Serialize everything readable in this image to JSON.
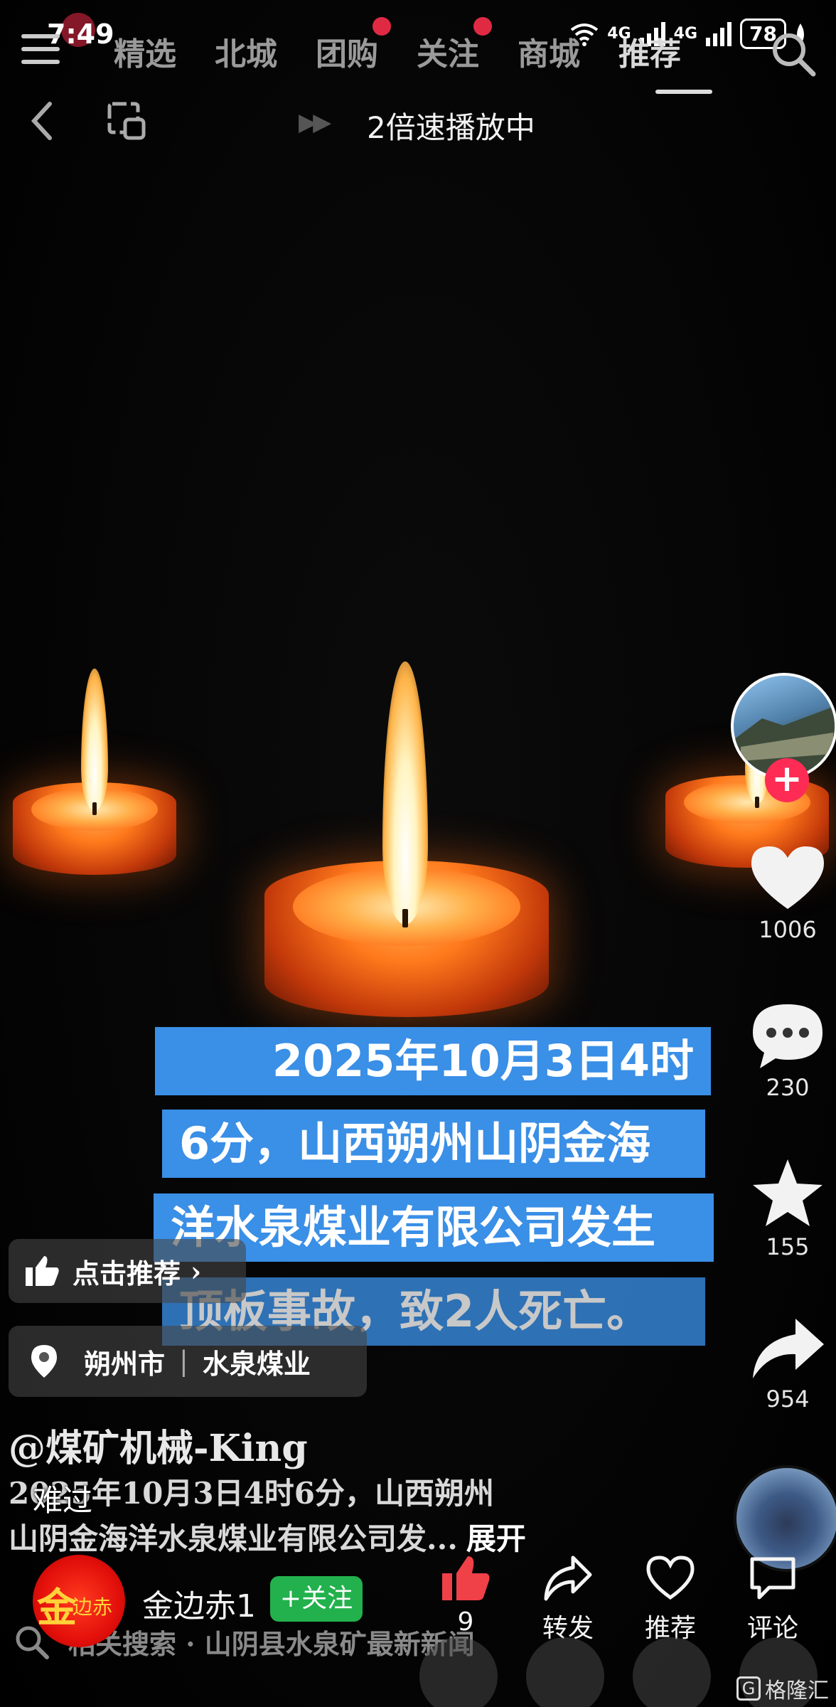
{
  "status_bar": {
    "time": "7:49",
    "net1": "4G",
    "net2": "4G",
    "battery": "78"
  },
  "nav": {
    "tabs": [
      {
        "label": "精选"
      },
      {
        "label": "北城"
      },
      {
        "label": "团购"
      },
      {
        "label": "关注"
      },
      {
        "label": "商城"
      },
      {
        "label": "推荐"
      }
    ],
    "active_tab": "推荐"
  },
  "player": {
    "speed_text": "2倍速播放中"
  },
  "captions": [
    "2025年10月3日4时",
    "6分，山西朔州山阴金海",
    "洋水泉煤业有限公司发生",
    "顶板事故，致2人死亡。"
  ],
  "rail": {
    "likes": "1006",
    "comments": "230",
    "favorites": "155",
    "shares": "954"
  },
  "chips": {
    "recommend": "点击推荐",
    "location_city": "朔州市",
    "location_place": "水泉煤业"
  },
  "post": {
    "author": "@煤矿机械-King",
    "desc_line1": "2025年10月3日4时6分，山西朔州",
    "desc_line2": "山阴金海洋水泉煤业有限公司发...",
    "expand": "展开",
    "danmaku": "难过"
  },
  "search": {
    "text": "相关搜索 · 山阴县水泉矿最新新闻"
  },
  "action_bar": {
    "poster_name": "金边赤1",
    "avatar_logo_big": "金",
    "avatar_logo_small": "边赤",
    "follow": "+关注",
    "like_count": "9",
    "share": "转发",
    "recommend": "推荐",
    "comment": "评论"
  },
  "watermark": {
    "icon_letter": "G",
    "text": "格隆汇"
  },
  "colors": {
    "caption_bg": "#3a8fe6",
    "follow_green": "#22b14c",
    "like_red": "#fe2c55"
  }
}
